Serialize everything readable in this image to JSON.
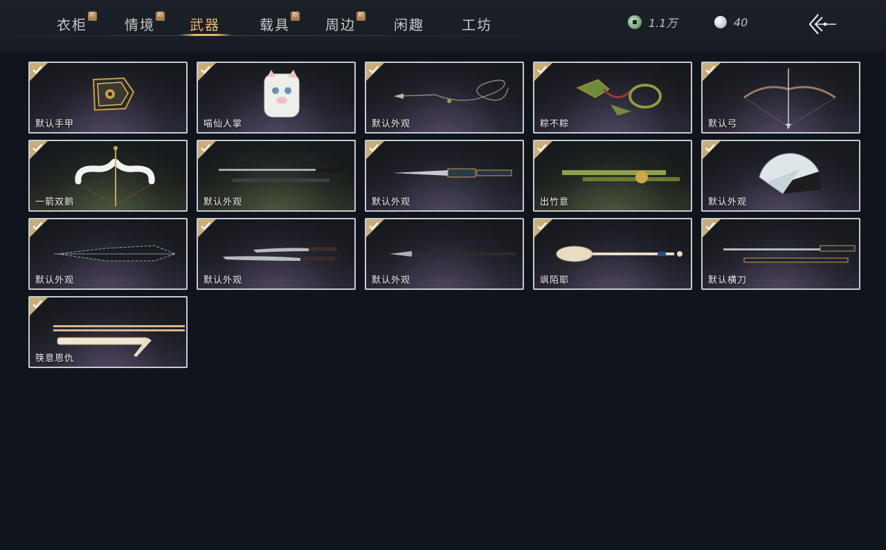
{
  "tabs": [
    {
      "label": "衣柜",
      "new": "新"
    },
    {
      "label": "情境",
      "new": "新"
    },
    {
      "label": "武器",
      "new": ""
    },
    {
      "label": "载具",
      "new": "新"
    },
    {
      "label": "周边",
      "new": "新"
    },
    {
      "label": "闲趣",
      "new": ""
    },
    {
      "label": "工坊",
      "new": ""
    }
  ],
  "active_tab": "武器",
  "currency": {
    "coins": "1.1万",
    "pearls": "40"
  },
  "items": [
    {
      "label": "默认手甲",
      "icon": "gauntlet-icon"
    },
    {
      "label": "喵仙人掌",
      "icon": "cat-paw-icon"
    },
    {
      "label": "默认外观",
      "icon": "rope-dart-icon"
    },
    {
      "label": "粽不粽",
      "icon": "zongzi-rope-dart-icon"
    },
    {
      "label": "默认弓",
      "icon": "bow-icon"
    },
    {
      "label": "一箭双鹅",
      "icon": "goose-bow-icon"
    },
    {
      "label": "默认外观",
      "icon": "double-sword-icon"
    },
    {
      "label": "默认外观",
      "icon": "ornate-sword-icon"
    },
    {
      "label": "出竹意",
      "icon": "bamboo-staff-icon"
    },
    {
      "label": "默认外观",
      "icon": "fan-icon"
    },
    {
      "label": "默认外观",
      "icon": "umbrella-icon"
    },
    {
      "label": "默认外观",
      "icon": "twin-sabres-icon"
    },
    {
      "label": "默认外观",
      "icon": "spear-icon"
    },
    {
      "label": "飒陌耶",
      "icon": "spoon-staff-icon"
    },
    {
      "label": "默认横刀",
      "icon": "hengdao-icon"
    },
    {
      "label": "筷意恩仇",
      "icon": "chopsticks-icon"
    }
  ],
  "colors": {
    "accent": "#e7b873",
    "background": "#10141b",
    "card_border": "#c9ccd2",
    "check_badge": "#c8ad78"
  }
}
